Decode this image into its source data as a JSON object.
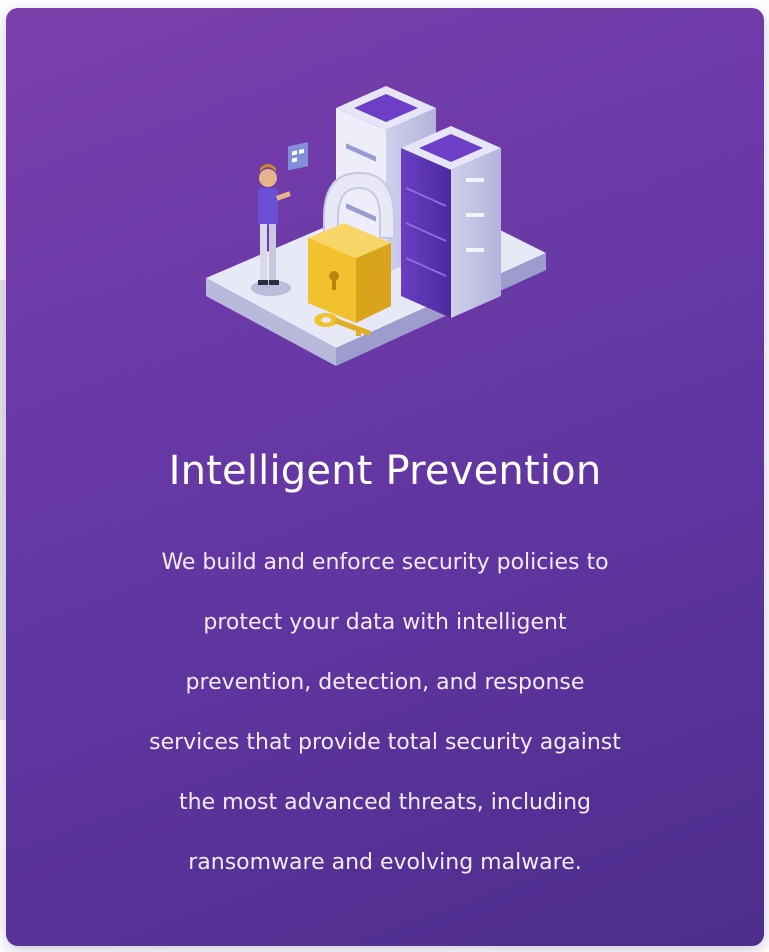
{
  "card": {
    "title": "Intelligent Prevention",
    "description_lines": [
      "We build and enforce security policies to",
      "protect your data with intelligent",
      "prevention, detection, and response",
      "services that provide total security against",
      "the most advanced threats, including",
      "ransomware and evolving malware."
    ]
  },
  "illustration": {
    "icon": "data-security-isometric-icon",
    "parts": [
      "server-rack-icon",
      "padlock-icon",
      "key-icon",
      "person-icon"
    ]
  },
  "colors": {
    "card_gradient_start": "#7b3fab",
    "card_gradient_end": "#4d2d8c",
    "title_text": "#ffffff",
    "body_text": "#f1ecf7",
    "padlock": "#f2c12e"
  }
}
